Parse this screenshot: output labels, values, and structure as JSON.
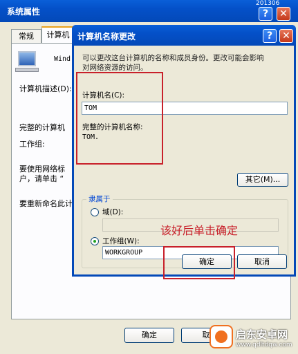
{
  "desktop": {
    "corner_text": "201306"
  },
  "back_window": {
    "title": "系统属性",
    "tabs": [
      "常规",
      "计算机"
    ],
    "win_label": "Wind",
    "desc_label": "计算机描述(D):",
    "full_name_label": "完整的计算机",
    "workgroup_label": "工作组:",
    "network_text_1": "要使用网络标",
    "network_text_2": "户，请单击 “",
    "rename_text": "要重新命名此计",
    "ok_label": "确定",
    "cancel_label": "取"
  },
  "dialog": {
    "title": "计算机名称更改",
    "help_glyph": "?",
    "close_glyph": "✕",
    "intro_line1": "可以更改这台计算机的名称和成员身份。更改可能会影响",
    "intro_line2": "对网络资源的访问。",
    "computer_name_label": "计算机名(C):",
    "computer_name_value": "TOM",
    "full_name_label": "完整的计算机名称:",
    "full_name_value": "TOM.",
    "other_button": "其它(M)...",
    "member_of_label": "隶属于",
    "domain_label": "域(D):",
    "domain_value": "",
    "workgroup_label": "工作组(W):",
    "workgroup_value": "WORKGROUP",
    "ok_label": "确定",
    "cancel_label": "取消"
  },
  "annotation": {
    "text": "该好后单击确定",
    "color": "#c8202a"
  },
  "watermark": {
    "brand": "启东安卓网",
    "url": "www.qdltdqw.com"
  }
}
